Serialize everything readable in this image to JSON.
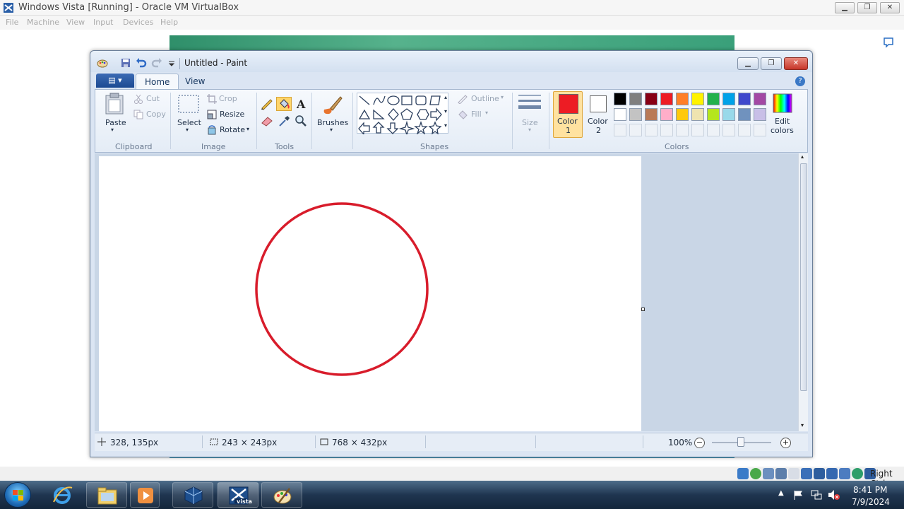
{
  "host": {
    "title": "Windows Vista [Running] - Oracle VM VirtualBox",
    "menu": [
      "File",
      "Machine",
      "View",
      "Input",
      "Devices",
      "Help"
    ],
    "status_right_label": "Right Ctrl"
  },
  "paint": {
    "title": "Untitled - Paint",
    "tabs": {
      "home": "Home",
      "view": "View"
    },
    "clipboard": {
      "paste": "Paste",
      "cut": "Cut",
      "copy": "Copy",
      "group": "Clipboard"
    },
    "image": {
      "select": "Select",
      "crop": "Crop",
      "resize": "Resize",
      "rotate": "Rotate",
      "group": "Image"
    },
    "tools": {
      "group": "Tools"
    },
    "brushes": {
      "label": "Brushes"
    },
    "shapes": {
      "outline": "Outline",
      "fill": "Fill",
      "group": "Shapes"
    },
    "size": {
      "label": "Size"
    },
    "colors": {
      "color1_line1": "Color",
      "color1_line2": "1",
      "color2_line1": "Color",
      "color2_line2": "2",
      "edit_line1": "Edit",
      "edit_line2": "colors",
      "group": "Colors",
      "palette_row1": [
        "#000000",
        "#7f7f7f",
        "#880015",
        "#ed1c24",
        "#ff7f27",
        "#fff200",
        "#22b14c",
        "#00a2e8",
        "#3f48cc",
        "#a349a4"
      ],
      "palette_row2": [
        "#ffffff",
        "#c3c3c3",
        "#b97a57",
        "#ffaec9",
        "#ffc90e",
        "#efe4b0",
        "#b5e61d",
        "#99d9ea",
        "#7092be",
        "#c8bfe7"
      ],
      "color1": "#ed1c24",
      "color2": "#ffffff"
    },
    "status": {
      "cursor": "328, 135px",
      "selection": "243 × 243px",
      "canvas_size": "768 × 432px",
      "zoom": "100%"
    },
    "drawing": {
      "stroke_color": "#d81c2b",
      "shape": "circle"
    }
  },
  "taskbar": {
    "time": "8:41 PM",
    "date": "7/9/2024",
    "vista_label": "vista"
  }
}
